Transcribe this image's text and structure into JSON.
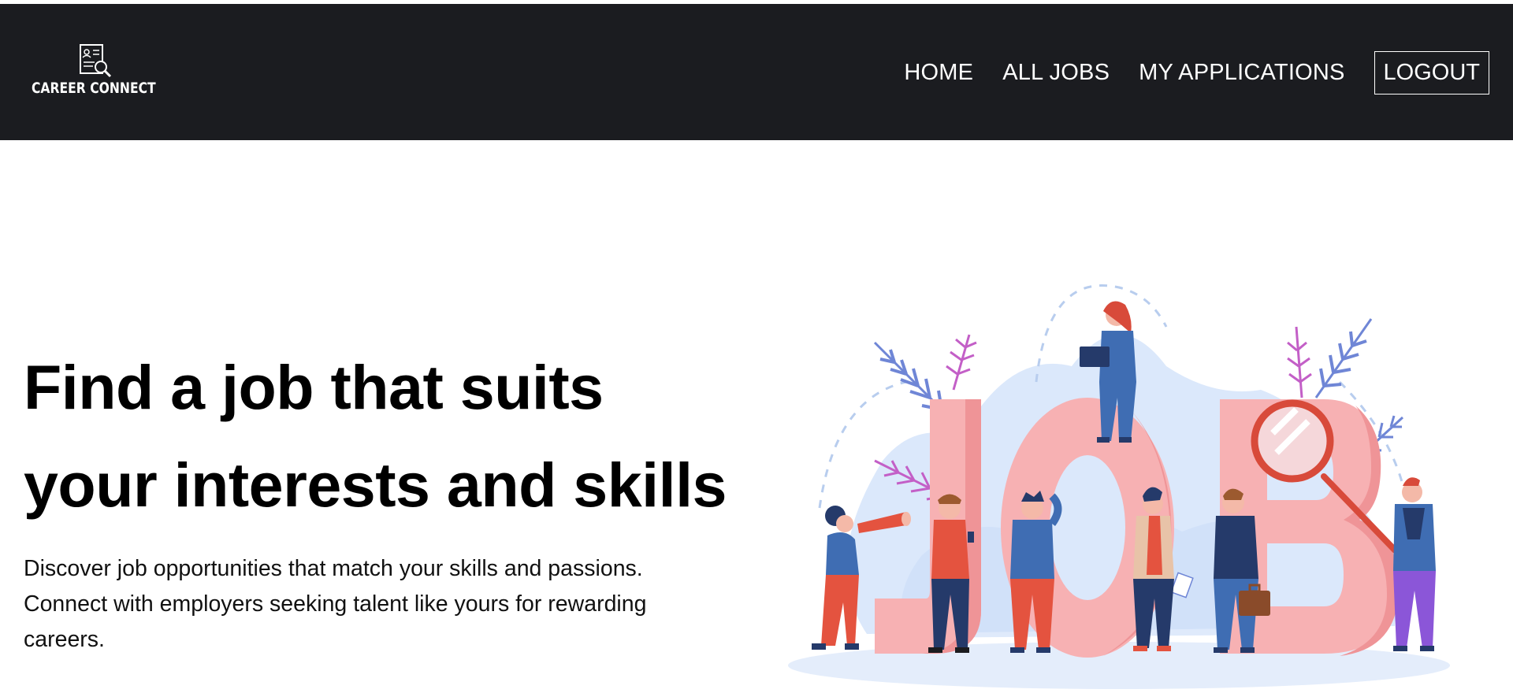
{
  "brand": {
    "name": "CAREER CONNECT",
    "logo_icon": "resume-search-icon"
  },
  "nav": {
    "home": "HOME",
    "all_jobs": "ALL JOBS",
    "my_applications": "MY APPLICATIONS",
    "logout": "LOGOUT"
  },
  "hero": {
    "title_line1": "Find a job that suits",
    "title_line2": "your interests and skills",
    "subtitle_line1": "Discover job opportunities that match your skills and passions.",
    "subtitle_line2": "Connect with employers seeking talent like yours for rewarding",
    "subtitle_line3": "careers.",
    "illustration_letters": [
      "J",
      "O",
      "B"
    ]
  },
  "colors": {
    "navbar_bg": "#1b1c20",
    "letter_pink": "#f7b1b3",
    "blob_blue": "#d7e6fb",
    "leaf_blue": "#6f86d6",
    "leaf_magenta": "#c35fc7",
    "figure_navy": "#253a6a",
    "figure_red": "#e4533f"
  }
}
